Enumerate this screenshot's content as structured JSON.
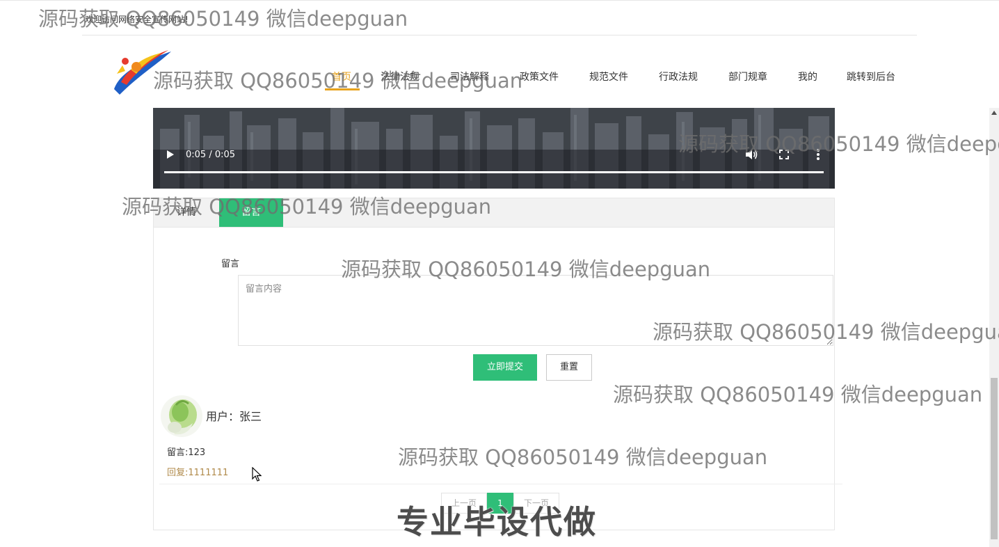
{
  "header": {
    "welcome_text": "欢迎访问网络安全宣传网站!",
    "nav": [
      {
        "label": "首页",
        "active": true
      },
      {
        "label": "法律法规",
        "active": false
      },
      {
        "label": "司法解释",
        "active": false
      },
      {
        "label": "政策文件",
        "active": false
      },
      {
        "label": "规范文件",
        "active": false
      },
      {
        "label": "行政法规",
        "active": false
      },
      {
        "label": "部门规章",
        "active": false
      },
      {
        "label": "我的",
        "active": false
      },
      {
        "label": "跳转到后台",
        "active": false
      }
    ]
  },
  "video": {
    "time": "0:05 / 0:05",
    "progress_fraction": 1.0
  },
  "tabs": [
    {
      "label": "详情",
      "active": false
    },
    {
      "label": "留言",
      "active": true
    }
  ],
  "form": {
    "label": "留言",
    "placeholder": "留言内容",
    "value": "",
    "submit_label": "立即提交",
    "reset_label": "重置"
  },
  "comment": {
    "user_text": "用户：张三",
    "content_text": "留言:123",
    "reply_text": "回复:1111111"
  },
  "pagination": {
    "prev": "上一页",
    "current": "1",
    "next": "下一页"
  },
  "watermarks": {
    "small": "源码获取 QQ86050149 微信deepguan",
    "big": "专业毕设代做"
  },
  "colors": {
    "accent_green": "#2fbe78",
    "nav_active": "#e7a21b",
    "reply_text": "#b08a4a"
  },
  "icons": [
    "logo-icon",
    "play-icon",
    "volume-icon",
    "fullscreen-icon",
    "more-icon",
    "avatar-image",
    "cursor-icon"
  ]
}
